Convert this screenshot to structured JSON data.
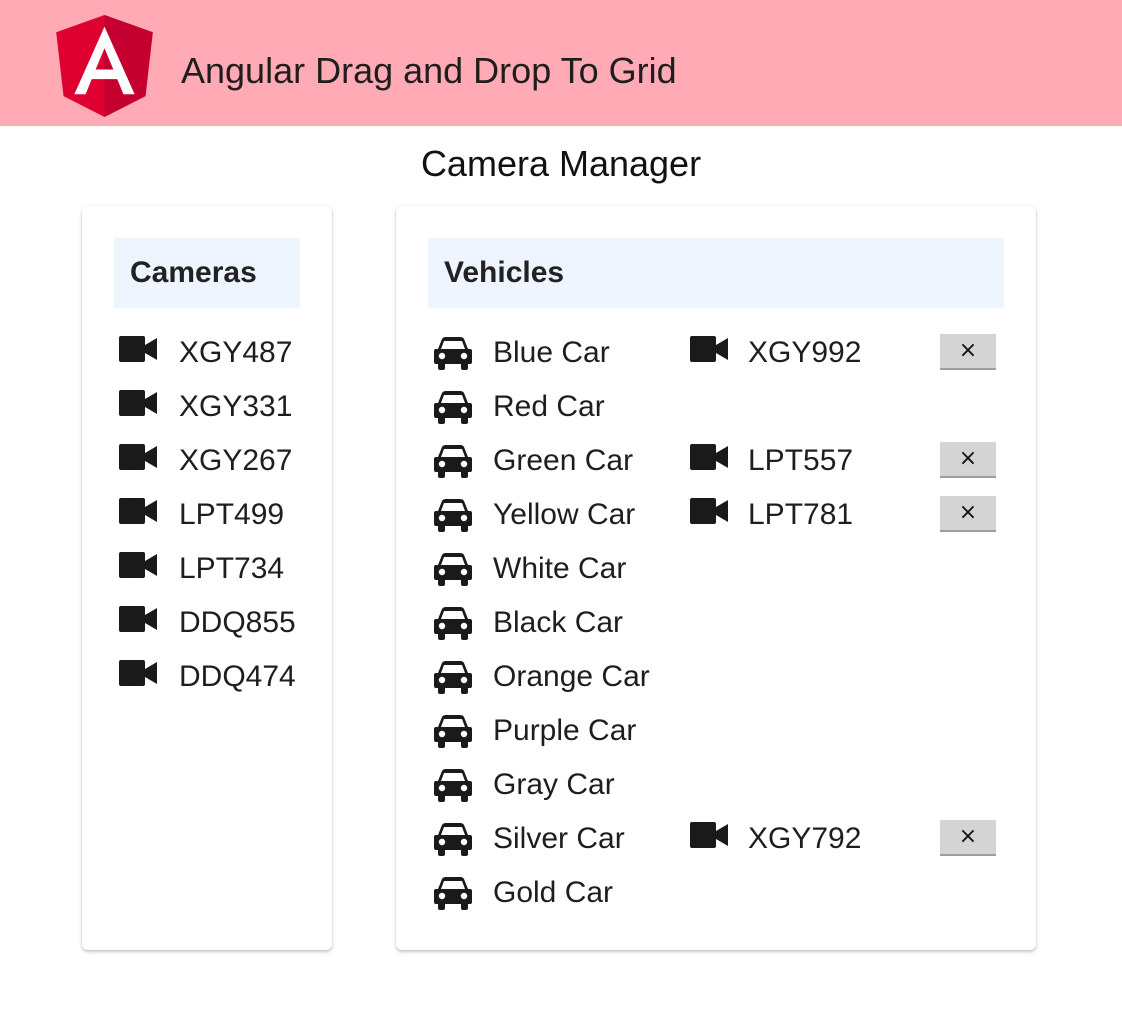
{
  "header": {
    "logo_letter": "A",
    "title": "Angular Drag and Drop To Grid"
  },
  "page": {
    "title": "Camera Manager"
  },
  "cameras_panel": {
    "heading": "Cameras",
    "items": [
      "XGY487",
      "XGY331",
      "XGY267",
      "LPT499",
      "LPT734",
      "DDQ855",
      "DDQ474"
    ]
  },
  "vehicles_panel": {
    "heading": "Vehicles",
    "items": [
      {
        "name": "Blue Car",
        "camera": "XGY992",
        "remove_label": "×"
      },
      {
        "name": "Red Car",
        "camera": null
      },
      {
        "name": "Green Car",
        "camera": "LPT557",
        "remove_label": "×"
      },
      {
        "name": "Yellow Car",
        "camera": "LPT781",
        "remove_label": "×"
      },
      {
        "name": "White Car",
        "camera": null
      },
      {
        "name": "Black Car",
        "camera": null
      },
      {
        "name": "Orange Car",
        "camera": null
      },
      {
        "name": "Purple Car",
        "camera": null
      },
      {
        "name": "Gray Car",
        "camera": null
      },
      {
        "name": "Silver Car",
        "camera": "XGY792",
        "remove_label": "×"
      },
      {
        "name": "Gold Car",
        "camera": null
      }
    ]
  },
  "icons": {
    "camera": "video-camera-icon",
    "vehicle": "car-icon",
    "remove": "close-icon"
  },
  "colors": {
    "header_bg": "#ffaab5",
    "card_header_bg": "#eef5fe",
    "logo_red": "#dd0031",
    "logo_dark_red": "#c3002f",
    "button_bg": "#d4d4d4"
  }
}
